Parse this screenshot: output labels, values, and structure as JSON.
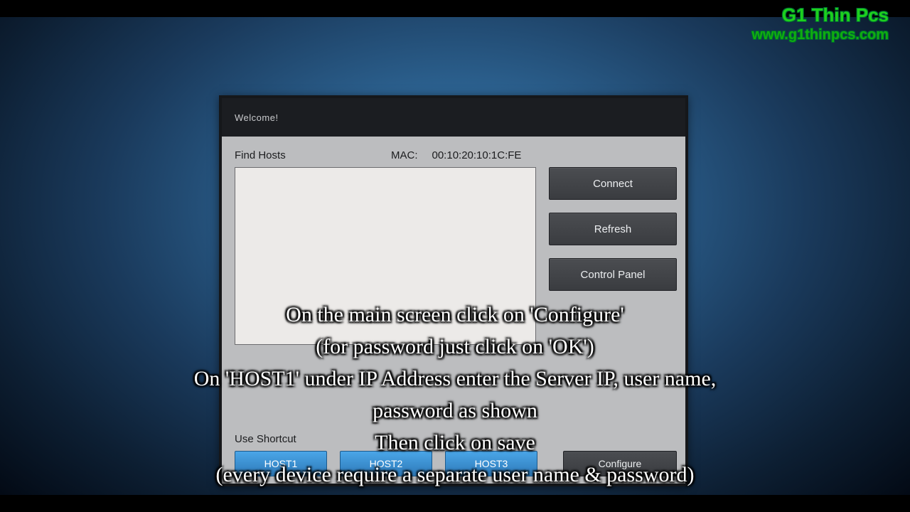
{
  "watermark": {
    "title": "G1 Thin Pcs",
    "url": "www.g1thinpcs.com"
  },
  "window": {
    "title": "Welcome!"
  },
  "header": {
    "find_hosts_label": "Find Hosts",
    "mac_label": "MAC:",
    "mac_value": "00:10:20:10:1C:FE"
  },
  "buttons": {
    "connect": "Connect",
    "refresh": "Refresh",
    "control_panel": "Control Panel"
  },
  "shortcut": {
    "label": "Use Shortcut",
    "hosts": [
      "HOST1",
      "HOST2",
      "HOST3"
    ],
    "configure": "Configure"
  },
  "caption": {
    "l1": "On the main screen click on 'Configure'",
    "l2": "(for password just click on 'OK')",
    "l3": "On 'HOST1' under IP Address enter the Server IP, user name,",
    "l4": "password as shown",
    "l5": "Then click on save",
    "l6": "(every device require a separate user name & password)"
  }
}
